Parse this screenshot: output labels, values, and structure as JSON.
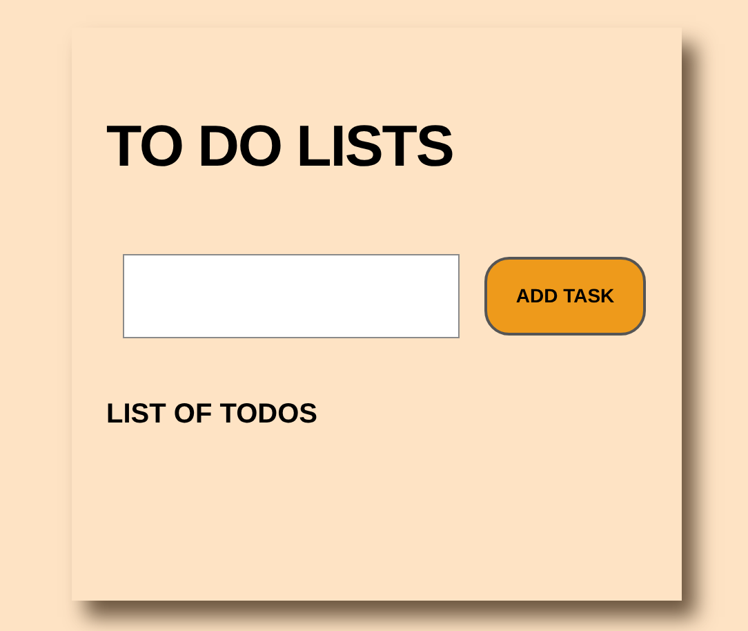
{
  "title": "TO DO LISTS",
  "add_button": {
    "label": "ADD TASK"
  },
  "list_heading": "LIST OF TODOS"
}
